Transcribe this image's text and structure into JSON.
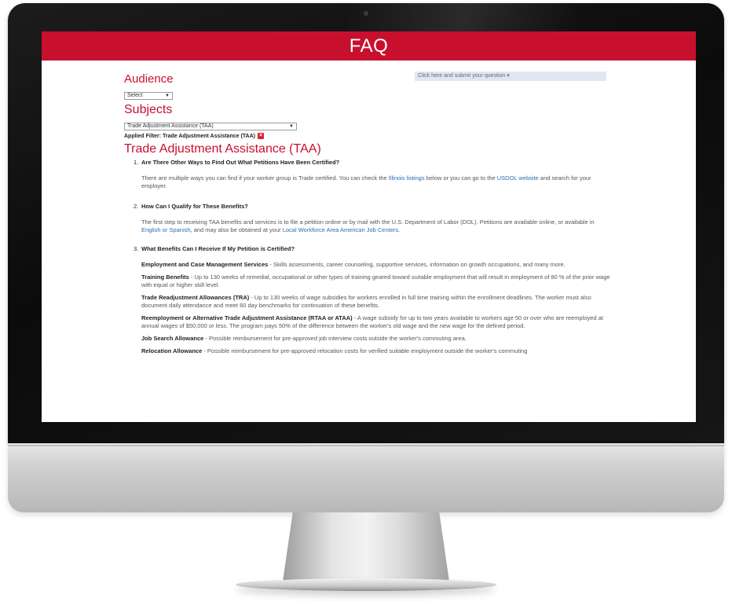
{
  "banner": {
    "title": "FAQ"
  },
  "audience": {
    "label": "Audience",
    "selected": "Select"
  },
  "subjects": {
    "label": "Subjects",
    "selected": "Trade Adjustment Assistance (TAA)"
  },
  "filter": {
    "text": "Applied Filter: Trade Adjustment Assistance (TAA)",
    "remove_glyph": "×"
  },
  "question_select": {
    "placeholder": "Click here and submit your question"
  },
  "section": {
    "title": "Trade Adjustment Assistance (TAA)"
  },
  "questions": [
    {
      "num": "1.",
      "question": "Are There Other Ways to Find Out What Petitions Have Been Certified?",
      "answer_pre": "There are multiple ways you can find if your worker group is Trade certified. You can check the ",
      "answer_link1": "Illinois listings",
      "answer_mid": " below or you can go to the ",
      "answer_link2": "USDOL website",
      "answer_post": " and search for your employer."
    },
    {
      "num": "2.",
      "question": "How Can I Qualify for These Benefits?",
      "answer_pre": "The first step to receiving TAA benefits and services is to file a petition online or by mail with the U.S. Department of Labor (DOL). Petitions are available online, or available in ",
      "answer_link1": "English or Spanish",
      "answer_mid": ", and may also be obtained at your ",
      "answer_link2": "Local Workforce Area American Job Centers",
      "answer_post": "."
    },
    {
      "num": "3.",
      "question": "What Benefits Can I Receive If My Petition is Certified?"
    }
  ],
  "benefits": [
    {
      "name": "Employment and Case Management Services",
      "desc": " - Skills assessments, career counseling, supportive services, information on growth occupations, and many more."
    },
    {
      "name": "Training Benefits",
      "desc": " - Up to 130 weeks of remedial, occupational or other types of training geared toward suitable employment that will result in employment of 80 % of the prior wage with equal or higher skill level."
    },
    {
      "name": "Trade Readjustment Allowances (TRA)",
      "desc": " - Up to 130 weeks of wage subsidies for workers enrolled in full time training within the enrollment deadlines. The worker must also document daily attendance and meet 60 day benchmarks for continuation of these benefits."
    },
    {
      "name": "Reemployment or Alternative Trade Adjustment Assistance (RTAA or ATAA)",
      "desc": " - A wage subsidy for up to two years available to workers age 50 or over who are reemployed at annual wages of $50,000 or less. The program pays 50% of the difference between the worker's old wage and the new wage for the defined period."
    },
    {
      "name": "Job Search Allowance",
      "desc": " - Possible reimbursement for pre-approved job interview costs outside the worker's commuting area."
    },
    {
      "name": "Relocation Allowance",
      "desc": " - Possible reimbursement for pre-approved relocation costs for verified suitable employment outside the worker's commuting"
    }
  ]
}
